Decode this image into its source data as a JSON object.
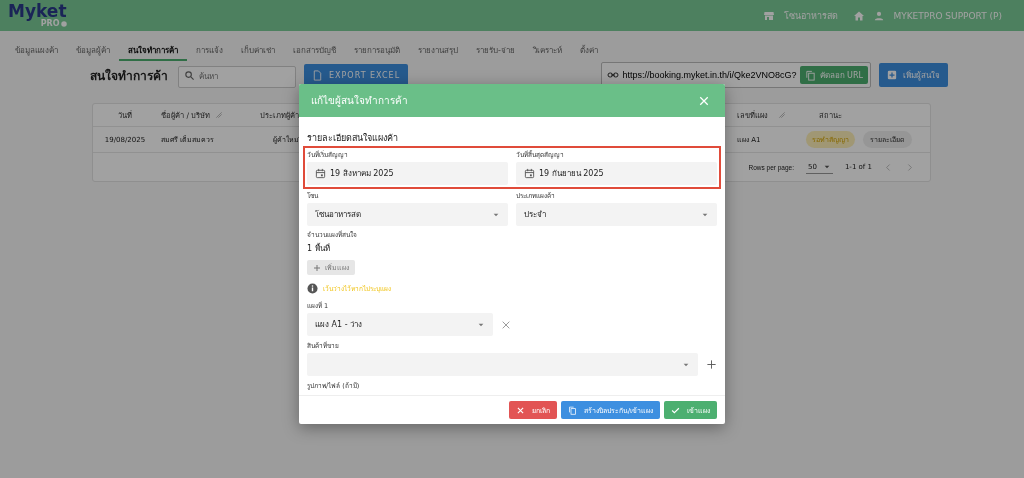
{
  "header": {
    "logo": "Myket",
    "logo_sub": "PRO",
    "zone": "โซนอาหารสด",
    "user": "MYKETPRO SUPPORT (P)"
  },
  "nav": [
    {
      "label": "ข้อมูลแผงค้า",
      "selected": false
    },
    {
      "label": "ข้อมูลผู้ค้า",
      "selected": false
    },
    {
      "label": "สนใจทำการค้า",
      "selected": true
    },
    {
      "label": "การแจ้ง",
      "selected": false
    },
    {
      "label": "เก็บค่าเช่า",
      "selected": false
    },
    {
      "label": "เอกสารบัญชี",
      "selected": false
    },
    {
      "label": "รายการอนุมัติ",
      "selected": false
    },
    {
      "label": "รายงานสรุป",
      "selected": false
    },
    {
      "label": "รายรับ-จ่าย",
      "selected": false
    },
    {
      "label": "วิเคราะห์",
      "selected": false
    },
    {
      "label": "ตั้งค่า",
      "selected": false
    }
  ],
  "toolbar": {
    "title": "สนใจทำการค้า",
    "search": {
      "placeholder": "ค้นหา"
    },
    "export_button": "EXPORT EXCEL",
    "url": "https://booking.myket.in.th/i/Qke2VNO8cG?",
    "copy_button": "คัดลอก URL",
    "add_button": "เพิ่มผู้สนใจ"
  },
  "table": {
    "columns": [
      "วันที่",
      "ชื่อผู้ค้า / บริษัท",
      "ประเภทผู้ค้า",
      "เลขที่แผง",
      "สถานะ"
    ],
    "rows": [
      {
        "date": "19/08/2025",
        "name": "สมศรี เต็มสมควร",
        "type": "ผู้ค้าใหม่",
        "stall": "แผง A1",
        "status": "รอทำสัญญา",
        "action": "รายละเอียด"
      }
    ],
    "pagination": {
      "rows_label": "Rows per page:",
      "rows_value": "50",
      "range": "1-1 of 1"
    }
  },
  "dialog": {
    "title": "แก้ไขผู้สนใจทำการค้า",
    "section_title": "รายละเอียดสนใจแผงค้า",
    "date_fields": [
      {
        "label": "วันที่เริ่มสัญญา",
        "value": "19 สิงหาคม 2025"
      },
      {
        "label": "วันที่สิ้นสุดสัญญา",
        "value": "19 กันยายน 2025"
      }
    ],
    "select_fields": [
      {
        "label": "โซน",
        "value": "โซนอาหารสด"
      },
      {
        "label": "ประเภทแผงค้า",
        "value": "ประจำ"
      }
    ],
    "stall_count": {
      "label": "จำนวนแผงที่สนใจ",
      "value": "1 พื้นที่"
    },
    "add_stall_button": {
      "label": "เพิ่มแผง",
      "disabled": true
    },
    "hint": "เว้นว่างไว้หากไม่ระบุแผง",
    "stalls": [
      {
        "label": "แผงที่ 1",
        "value": "แผง A1 - ว่าง"
      }
    ],
    "products_label": "สินค้าที่ขาย",
    "attachments_label": "รูปภาพ/ไฟล์ (ถ้ามี)",
    "buttons": [
      {
        "label": "ยกเลิก",
        "kind": "cancel"
      },
      {
        "label": "สร้างบิลประกัน/เข้าแผง",
        "kind": "bill"
      },
      {
        "label": "เข้าแผง",
        "kind": "confirm"
      }
    ]
  }
}
